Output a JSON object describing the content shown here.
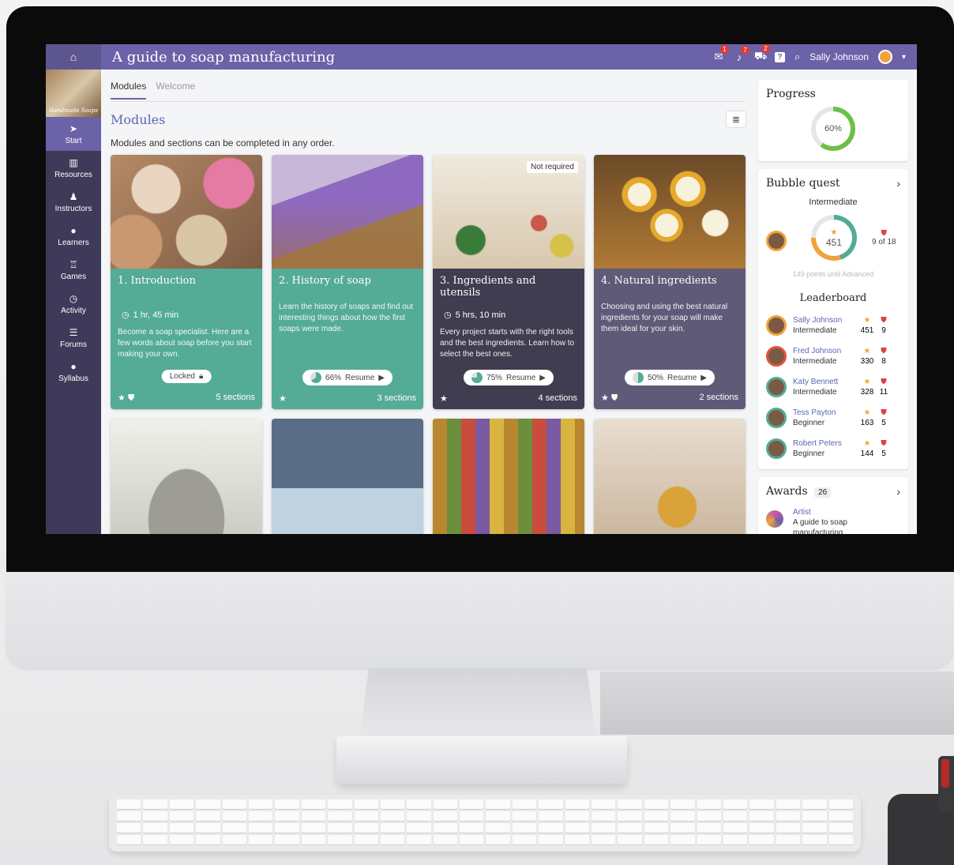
{
  "app": {
    "title": "A guide to soap manufacturing",
    "home_icon": "home-icon",
    "notifications": [
      {
        "icon": "message-icon",
        "count": "1"
      },
      {
        "icon": "bell-icon",
        "count": "7"
      },
      {
        "icon": "cart-icon",
        "count": "2"
      }
    ],
    "help_label": "?",
    "user": {
      "name": "Sally Johnson"
    },
    "accent": "#6b62a8"
  },
  "sidebar": {
    "logo_text": "Handmade Soaps",
    "items": [
      {
        "label": "Start",
        "icon": "arrow-icon",
        "glyph": "➤",
        "active": true
      },
      {
        "label": "Resources",
        "icon": "book-icon",
        "glyph": "▥",
        "active": false
      },
      {
        "label": "Instructors",
        "icon": "instructor-icon",
        "glyph": "♟",
        "active": false
      },
      {
        "label": "Learners",
        "icon": "person-icon",
        "glyph": "●",
        "active": false
      },
      {
        "label": "Games",
        "icon": "trophy-icon",
        "glyph": "♖",
        "active": false
      },
      {
        "label": "Activity",
        "icon": "clock-icon",
        "glyph": "◷",
        "active": false
      },
      {
        "label": "Forums",
        "icon": "forum-icon",
        "glyph": "☰",
        "active": false
      },
      {
        "label": "Syllabus",
        "icon": "info-icon",
        "glyph": "●",
        "active": false
      }
    ]
  },
  "main": {
    "tabs": [
      {
        "label": "Modules",
        "active": true
      },
      {
        "label": "Welcome",
        "active": false
      }
    ],
    "section_title": "Modules",
    "section_subtitle": "Modules and sections can be completed in any order.",
    "cards": [
      {
        "title": "1. Introduction",
        "duration": "1 hr, 45 min",
        "description": "Become a soap specialist. Here are a few words about soap before you start making your own.",
        "action": "Locked",
        "progress": null,
        "sections": "5 sections",
        "tag": "",
        "image": "soaps"
      },
      {
        "title": "2. History of soap",
        "duration": "",
        "description": "Learn the history of soaps and find out interesting things about how the first soaps were made.",
        "action": "Resume",
        "progress": "66%",
        "sections": "3 sections",
        "tag": "",
        "image": "lavender"
      },
      {
        "title": "3. Ingredients and utensils",
        "duration": "5 hrs, 10 min",
        "description": "Every project starts with the right tools and the best ingredients. Learn how to select the best ones.",
        "action": "Resume",
        "progress": "75%",
        "sections": "4 sections",
        "tag": "Not required",
        "image": "ingredients"
      },
      {
        "title": "4. Natural ingredients",
        "duration": "",
        "description": "Choosing and using the best natural ingredients for your soap will make them ideal for your skin.",
        "action": "Resume",
        "progress": "50%",
        "sections": "2 sections",
        "tag": "",
        "image": "chamomile"
      }
    ]
  },
  "progress": {
    "title": "Progress",
    "value": "60%",
    "fraction": 0.6
  },
  "bubble_quest": {
    "title": "Bubble quest",
    "level": "Intermediate",
    "points": "451",
    "fraction": 0.75,
    "badges": "9 of 18",
    "next_level_text": "149 points until Advanced"
  },
  "leaderboard": {
    "title": "Leaderboard",
    "rows": [
      {
        "name": "Sally Johnson",
        "level": "Intermediate",
        "points": "451",
        "badges": "9"
      },
      {
        "name": "Fred Johnson",
        "level": "Intermediate",
        "points": "330",
        "badges": "8"
      },
      {
        "name": "Katy Bennett",
        "level": "Intermediate",
        "points": "328",
        "badges": "11"
      },
      {
        "name": "Tess Payton",
        "level": "Beginner",
        "points": "163",
        "badges": "5"
      },
      {
        "name": "Robert Peters",
        "level": "Beginner",
        "points": "144",
        "badges": "5"
      }
    ]
  },
  "awards": {
    "title": "Awards",
    "count": "26",
    "item_title": "Artist",
    "item_desc": "A guide to soap manufacturing"
  }
}
